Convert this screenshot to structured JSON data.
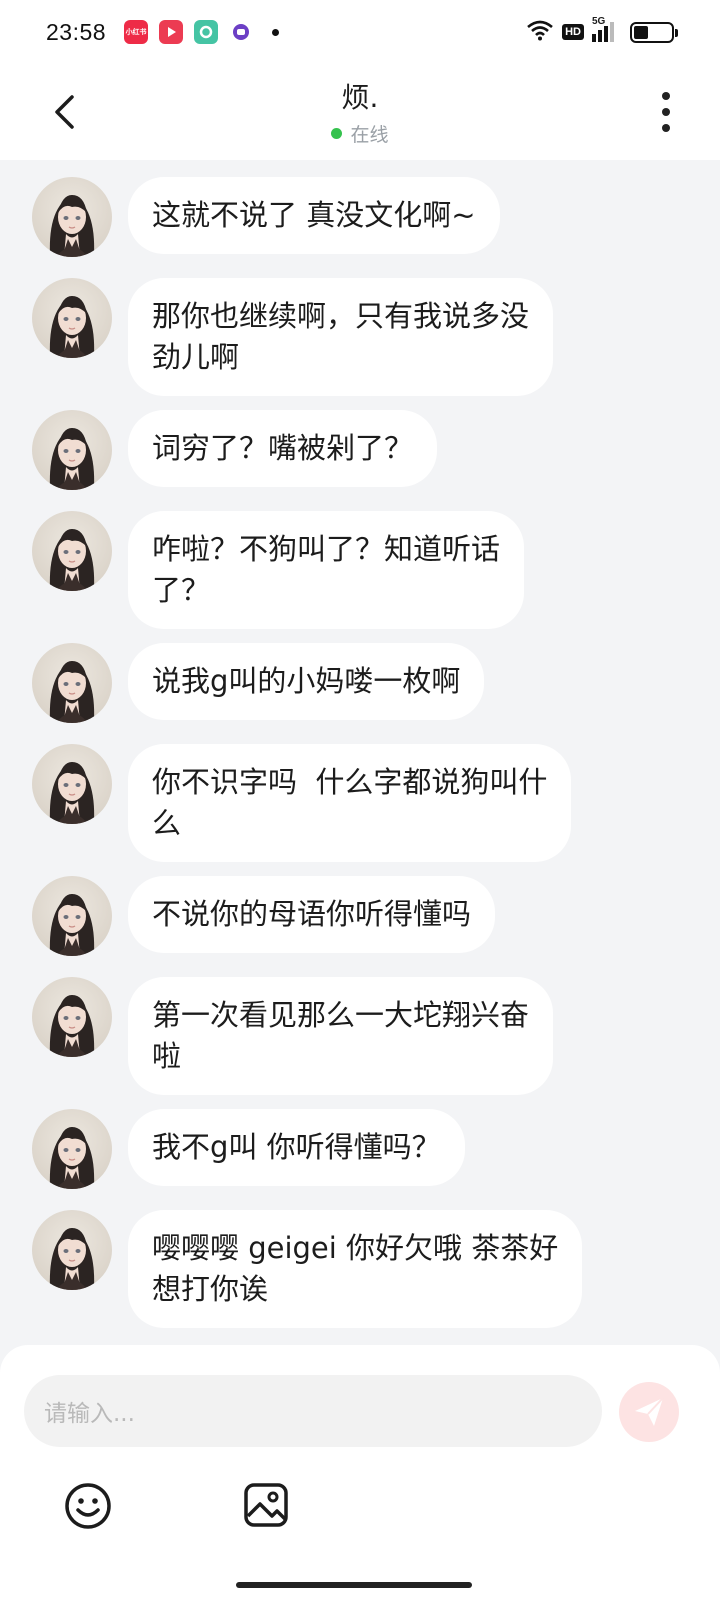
{
  "status_bar": {
    "time": "23:58",
    "icons": [
      "xiaohongshu-icon",
      "video-play-icon",
      "green-app-icon",
      "purple-app-icon"
    ],
    "xhs_label": "小红书",
    "hd": "HD",
    "network": "5G",
    "battery_level": 0.4
  },
  "header": {
    "title": "烦.",
    "status": "在线",
    "status_color": "#35c24e"
  },
  "messages": [
    {
      "text": "这就不说了 真没文化啊~"
    },
    {
      "text": "那你也继续啊，只有我说多没\n劲儿啊"
    },
    {
      "text": "词穷了？嘴被剁了？"
    },
    {
      "text": "咋啦？不狗叫了？知道听话\n了？"
    },
    {
      "text": "说我g叫的小妈喽一枚啊"
    },
    {
      "text": "你不识字吗  什么字都说狗叫什\n么"
    },
    {
      "text": "不说你的母语你听得懂吗"
    },
    {
      "text": "第一次看见那么一大坨翔兴奋\n啦"
    },
    {
      "text": "我不g叫 你听得懂吗？"
    },
    {
      "text": "嘤嘤嘤 geigei 你好欠哦 茶茶好\n想打你诶"
    }
  ],
  "composer": {
    "placeholder": "请输入...",
    "send_color": "#fde3e3"
  }
}
